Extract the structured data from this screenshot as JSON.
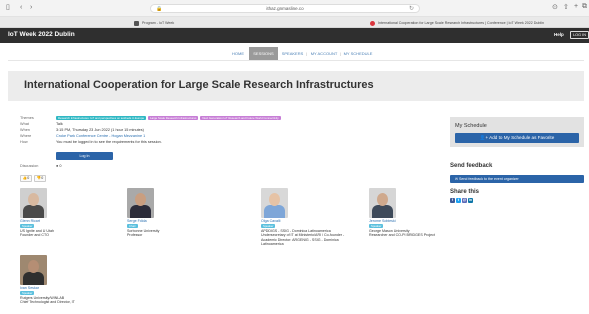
{
  "browser": {
    "url": "ithaz.gnmasline.co",
    "tabs": [
      {
        "title": "Program - IoT Week",
        "color": "#555555"
      },
      {
        "title": "International Cooperation for Large Scale Research Infrastructures | Conference | IoT Week 2022 Dublin",
        "color": "#d9363e"
      }
    ],
    "icons": {
      "sidebar": "sidebar-icon",
      "back": "back-icon",
      "forward": "forward-icon",
      "lock": "lock-icon",
      "reload": "reload-icon",
      "download": "download-icon",
      "share": "share-icon",
      "new_tab": "plus-icon",
      "tabs": "tabs-icon"
    }
  },
  "site": {
    "title": "IoT Week 2022 Dublin",
    "help": "Help",
    "login": "LOG IN"
  },
  "nav": {
    "items": [
      {
        "label": "HOME",
        "active": false
      },
      {
        "label": "SESSIONS",
        "active": true
      },
      {
        "label": "SPEAKERS",
        "active": false
      },
      {
        "label": "MY ACCOUNT",
        "active": false
      },
      {
        "label": "MY SCHEDULE",
        "active": false
      }
    ]
  },
  "session": {
    "title": "International Cooperation for Large Scale Research Infrastructures",
    "labels": {
      "themes": "Themes",
      "what": "What",
      "when": "When",
      "where": "Where",
      "how": "How",
      "discussion": "Discussion"
    },
    "themes": [
      {
        "label": "Research Infrastructures: IoT and perspectives on testbeds in Europe",
        "color": "#2fb8c4"
      },
      {
        "label": "Large Scale Research Infrastructures",
        "color": "#c77ed6"
      },
      {
        "label": "Next Generation IoT Research and Future World Connectivity",
        "color": "#c77ed6"
      }
    ],
    "what": "Talk",
    "when": "3:15 PM, Thursday 23 Jun 2022 (1 hour 15 minutes)",
    "where": "Croke Park Conference Centre - Hogan Mezzanine 1",
    "how": "You must be logged in to see the requirements for this session.",
    "login_button": "Log In",
    "discussion_count": "0",
    "likes": "0",
    "dislikes": "0"
  },
  "speakers": [
    {
      "name": "Glenn Ricart",
      "role": "Speaker",
      "org": "US Ignite and U Utah\nFounder and CTO",
      "skin": "#d8b9a0",
      "shirt": "#4a4a4a",
      "bg": "#cfcfcf"
    },
    {
      "name": "Serge Fdida",
      "role": "Chair",
      "org": "Sorbonne University\nProfessor",
      "skin": "#c99e80",
      "shirt": "#2c2c3a",
      "bg": "#a9a9a9"
    },
    {
      "name": "Olga Cavalli",
      "role": "Speaker",
      "org": "APDDIGS - SSIG - Dominica Latinoamerica\nUndersecretary of IT at Ministerio/ARI / Co-founder -\nAcademic Director: ARGENIG - SSIG - Dominica\nLatinoamerica",
      "skin": "#e6c3a6",
      "shirt": "#7ea6d8",
      "bg": "#d8d8d8"
    },
    {
      "name": "Jerome Sobieski",
      "role": "Speaker",
      "org": "George Mason University\nResearcher and CO-PI BRIDGES Project",
      "skin": "#cfa98d",
      "shirt": "#3e4a5a",
      "bg": "#d6d6d6"
    },
    {
      "name": "Ivan Seskar",
      "role": "Speaker",
      "org": "Rutgers University/WINLAB\nChief Technologist and Director, IT",
      "skin": "#b58e74",
      "shirt": "#2f2f2f",
      "bg": "#9e8870"
    }
  ],
  "sidebar": {
    "schedule_title": "My Schedule",
    "schedule_button": "Add to My Schedule as Favorite",
    "feedback_title": "Send feedback",
    "feedback_button": "Send feedback to the event organizer",
    "share_title": "Share this",
    "share_icons": [
      {
        "name": "facebook-icon",
        "glyph": "f",
        "color": "#3b5998"
      },
      {
        "name": "twitter-icon",
        "glyph": "t",
        "color": "#1da1f2"
      },
      {
        "name": "email-icon",
        "glyph": "@",
        "color": "#5b6ab8"
      },
      {
        "name": "linkedin-icon",
        "glyph": "in",
        "color": "#0e76a8"
      }
    ]
  }
}
